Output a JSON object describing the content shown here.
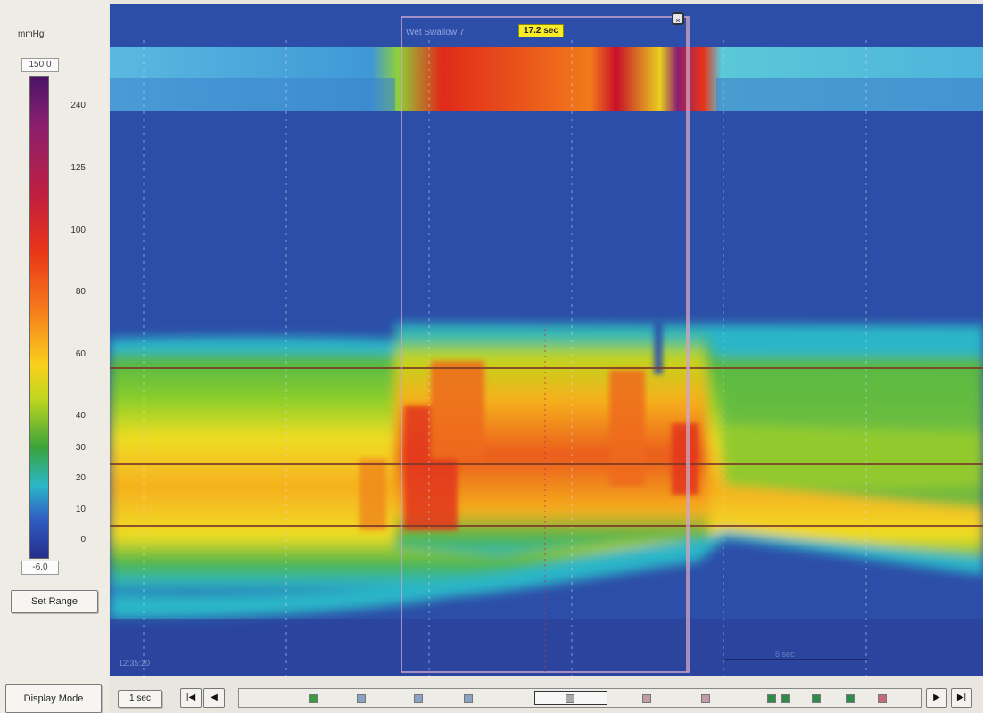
{
  "scale": {
    "unit": "mmHg",
    "max": "150.0",
    "min": "-6.0",
    "ticks": [
      "240",
      "125",
      "100",
      "80",
      "60",
      "40",
      "30",
      "20",
      "10",
      "0"
    ]
  },
  "buttons": {
    "set_range": "Set Range",
    "display_mode": "Display Mode",
    "zoom": "1 sec"
  },
  "selection": {
    "label": "Wet Swallow 7",
    "duration": "17.2 sec",
    "close": "×"
  },
  "plot": {
    "time_label": "12:35:20",
    "scale_label": "5 sec"
  },
  "navigation": {
    "first": "|◀",
    "prev": "◀",
    "next": "▶",
    "last": "▶|",
    "markers": [
      {
        "color": "#3a9b3a"
      },
      {
        "color": "#8ca2c4"
      },
      {
        "color": "#8ca2c4"
      },
      {
        "color": "#8ca2c4"
      },
      {
        "color": "#a9a9a9"
      },
      {
        "color": "#c39aa8"
      },
      {
        "color": "#c39aa8"
      },
      {
        "color": "#2f8b4a"
      },
      {
        "color": "#2f8b4a"
      },
      {
        "color": "#2f8b4a"
      },
      {
        "color": "#2f8b4a"
      },
      {
        "color": "#c46b7a"
      }
    ]
  },
  "colors": {
    "plot_background": "#2d4ea8",
    "selection_border": "#c8a0c8",
    "reference_line": "#8a3a2a"
  }
}
